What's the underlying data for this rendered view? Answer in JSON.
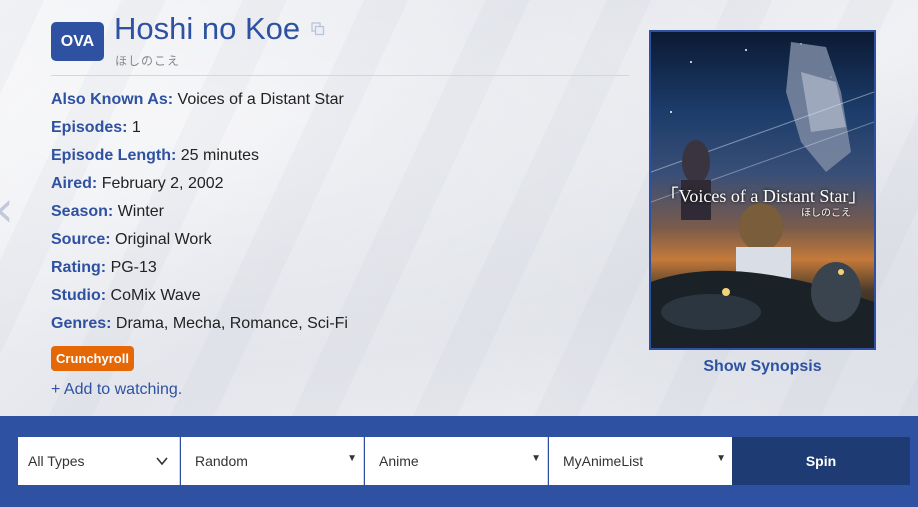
{
  "header": {
    "type_badge": "OVA",
    "title": "Hoshi no Koe",
    "japanese_title": "ほしのこえ"
  },
  "info": [
    {
      "key": "Also Known As:",
      "value": "Voices of a Distant Star"
    },
    {
      "key": "Episodes:",
      "value": "1"
    },
    {
      "key": "Episode Length:",
      "value": "25 minutes"
    },
    {
      "key": "Aired:",
      "value": "February 2, 2002"
    },
    {
      "key": "Season:",
      "value": "Winter"
    },
    {
      "key": "Source:",
      "value": "Original Work"
    },
    {
      "key": "Rating:",
      "value": "PG-13"
    },
    {
      "key": "Studio:",
      "value": "CoMix Wave"
    },
    {
      "key": "Genres:",
      "value": "Drama, Mecha, Romance, Sci-Fi"
    }
  ],
  "streaming": {
    "label": "Crunchyroll",
    "color": "#e56705"
  },
  "actions": {
    "add_watching": "+ Add to watching."
  },
  "cover": {
    "title_text": "「Voices of a Distant Star」",
    "subtitle_text": "ほしのこえ"
  },
  "synopsis": {
    "label": "Show Synopsis"
  },
  "filters": {
    "type": "All Types",
    "order": "Random",
    "media": "Anime",
    "source": "MyAnimeList",
    "spin_label": "Spin"
  },
  "colors": {
    "accent": "#2e51a2",
    "bar": "#2e51a2",
    "spin": "#1e3b74"
  },
  "icons": {
    "prev": "chevron-left-icon",
    "copy": "copy-icon",
    "type_dropdown": "chevron-down-icon",
    "select_caret": "caret-down-icon"
  }
}
